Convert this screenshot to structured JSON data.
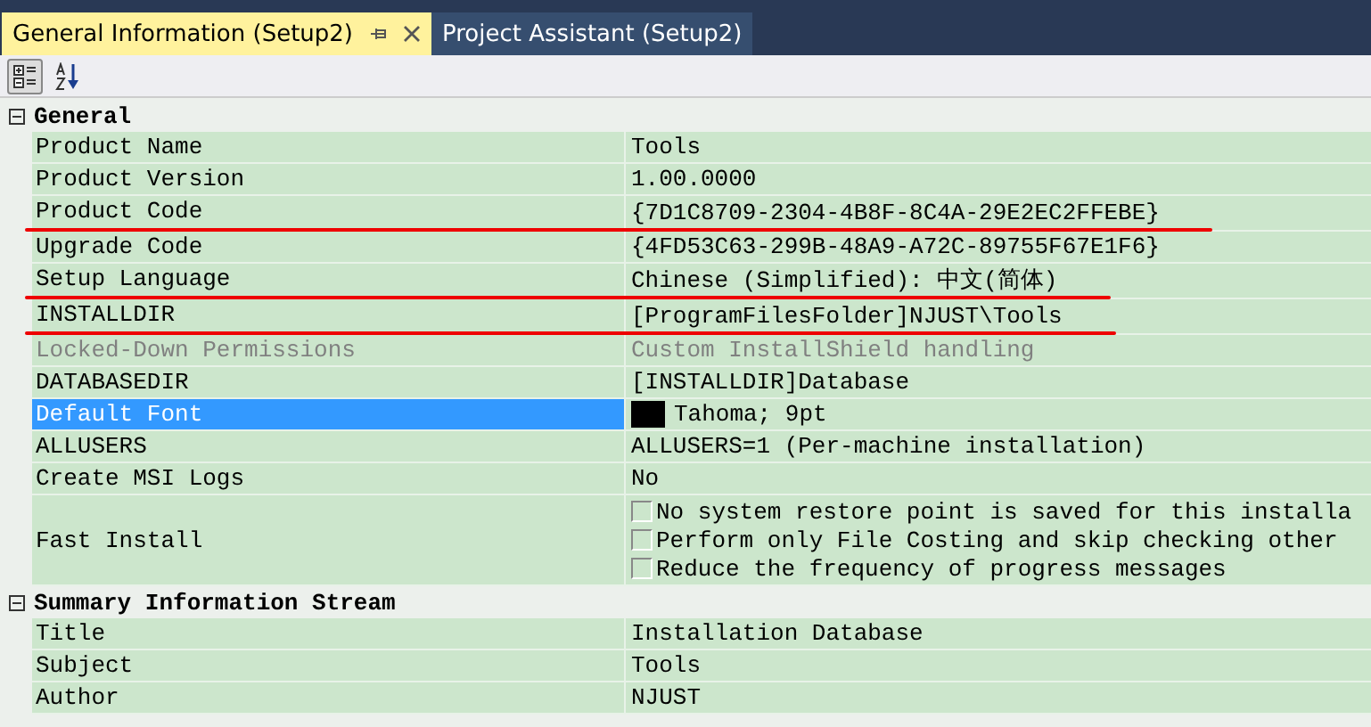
{
  "tabs": [
    {
      "label": "General Information (Setup2)",
      "selected": true
    },
    {
      "label": "Project Assistant (Setup2)",
      "selected": false
    }
  ],
  "toolbar": {
    "categorized_selected": true
  },
  "sections": [
    {
      "title": "General",
      "expanded": true,
      "rows": [
        {
          "kind": "text",
          "name": "Product Name",
          "value": "Tools",
          "selected": false,
          "disabled": false,
          "underlined": false
        },
        {
          "kind": "text",
          "name": "Product Version",
          "value": "1.00.0000",
          "selected": false,
          "disabled": false,
          "underlined": false
        },
        {
          "kind": "text",
          "name": "Product Code",
          "value": "{7D1C8709-2304-4B8F-8C4A-29E2EC2FFEBE}",
          "selected": false,
          "disabled": false,
          "underlined": true
        },
        {
          "kind": "text",
          "name": "Upgrade Code",
          "value": "{4FD53C63-299B-48A9-A72C-89755F67E1F6}",
          "selected": false,
          "disabled": false,
          "underlined": false
        },
        {
          "kind": "text",
          "name": "Setup Language",
          "value": "Chinese (Simplified): 中文(简体)",
          "selected": false,
          "disabled": false,
          "underlined": true
        },
        {
          "kind": "text",
          "name": "INSTALLDIR",
          "value": "[ProgramFilesFolder]NJUST\\Tools",
          "selected": false,
          "disabled": false,
          "underlined": true
        },
        {
          "kind": "text",
          "name": "Locked-Down Permissions",
          "value": "Custom InstallShield handling",
          "selected": false,
          "disabled": true,
          "underlined": false
        },
        {
          "kind": "text",
          "name": "DATABASEDIR",
          "value": "[INSTALLDIR]Database",
          "selected": false,
          "disabled": false,
          "underlined": false
        },
        {
          "kind": "font",
          "name": "Default Font",
          "value": "Tahoma; 9pt",
          "selected": true,
          "disabled": false,
          "underlined": false
        },
        {
          "kind": "text",
          "name": "ALLUSERS",
          "value": "ALLUSERS=1 (Per-machine installation)",
          "selected": false,
          "disabled": false,
          "underlined": false
        },
        {
          "kind": "text",
          "name": "Create MSI Logs",
          "value": "No",
          "selected": false,
          "disabled": false,
          "underlined": false
        },
        {
          "kind": "checks",
          "name": "Fast Install",
          "options": [
            {
              "label": "No system restore point is saved for this installa",
              "checked": false
            },
            {
              "label": "Perform only File Costing and skip checking other",
              "checked": false
            },
            {
              "label": "Reduce the frequency of progress messages",
              "checked": false
            }
          ],
          "selected": false,
          "disabled": false,
          "underlined": false
        }
      ]
    },
    {
      "title": "Summary Information Stream",
      "expanded": true,
      "rows": [
        {
          "kind": "text",
          "name": "Title",
          "value": "Installation Database",
          "selected": false,
          "disabled": false,
          "underlined": false
        },
        {
          "kind": "text",
          "name": "Subject",
          "value": "Tools",
          "selected": false,
          "disabled": false,
          "underlined": false
        },
        {
          "kind": "text",
          "name": "Author",
          "value": "NJUST",
          "selected": false,
          "disabled": false,
          "underlined": false
        }
      ]
    }
  ]
}
